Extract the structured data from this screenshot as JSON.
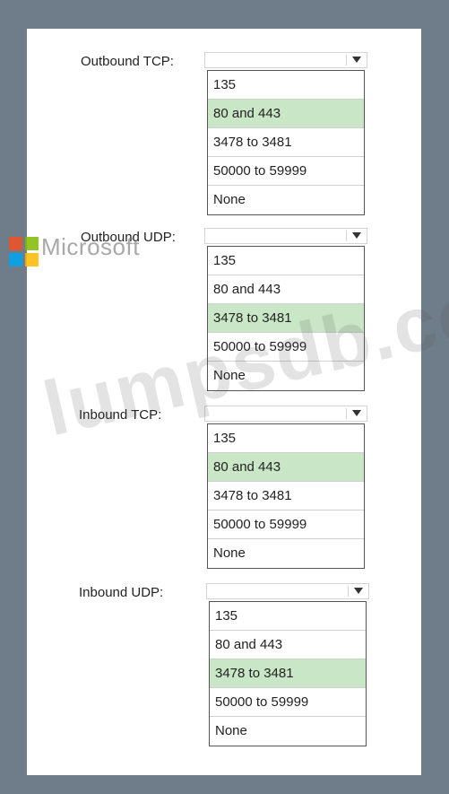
{
  "groups": [
    {
      "label": "Outbound TCP:",
      "options": [
        "135",
        "80 and 443",
        "3478 to 3481",
        "50000 to 59999",
        "None"
      ],
      "selected_index": 1
    },
    {
      "label": "Outbound UDP:",
      "options": [
        "135",
        "80 and 443",
        "3478 to 3481",
        "50000 to 59999",
        "None"
      ],
      "selected_index": 2
    },
    {
      "label": "Inbound TCP:",
      "options": [
        "135",
        "80 and 443",
        "3478 to 3481",
        "50000 to 59999",
        "None"
      ],
      "selected_index": 1
    },
    {
      "label": "Inbound UDP:",
      "options": [
        "135",
        "80 and 443",
        "3478 to 3481",
        "50000 to 59999",
        "None"
      ],
      "selected_index": 2
    }
  ],
  "watermark": {
    "brand": "Microsoft",
    "site": "lumpsdb.com"
  },
  "colors": {
    "frame": "#6f7d8a",
    "selected_highlight": "#c9e7c6",
    "logo_red": "#f25022",
    "logo_green": "#7fba00",
    "logo_blue": "#00a4ef",
    "logo_yellow": "#ffb900"
  }
}
